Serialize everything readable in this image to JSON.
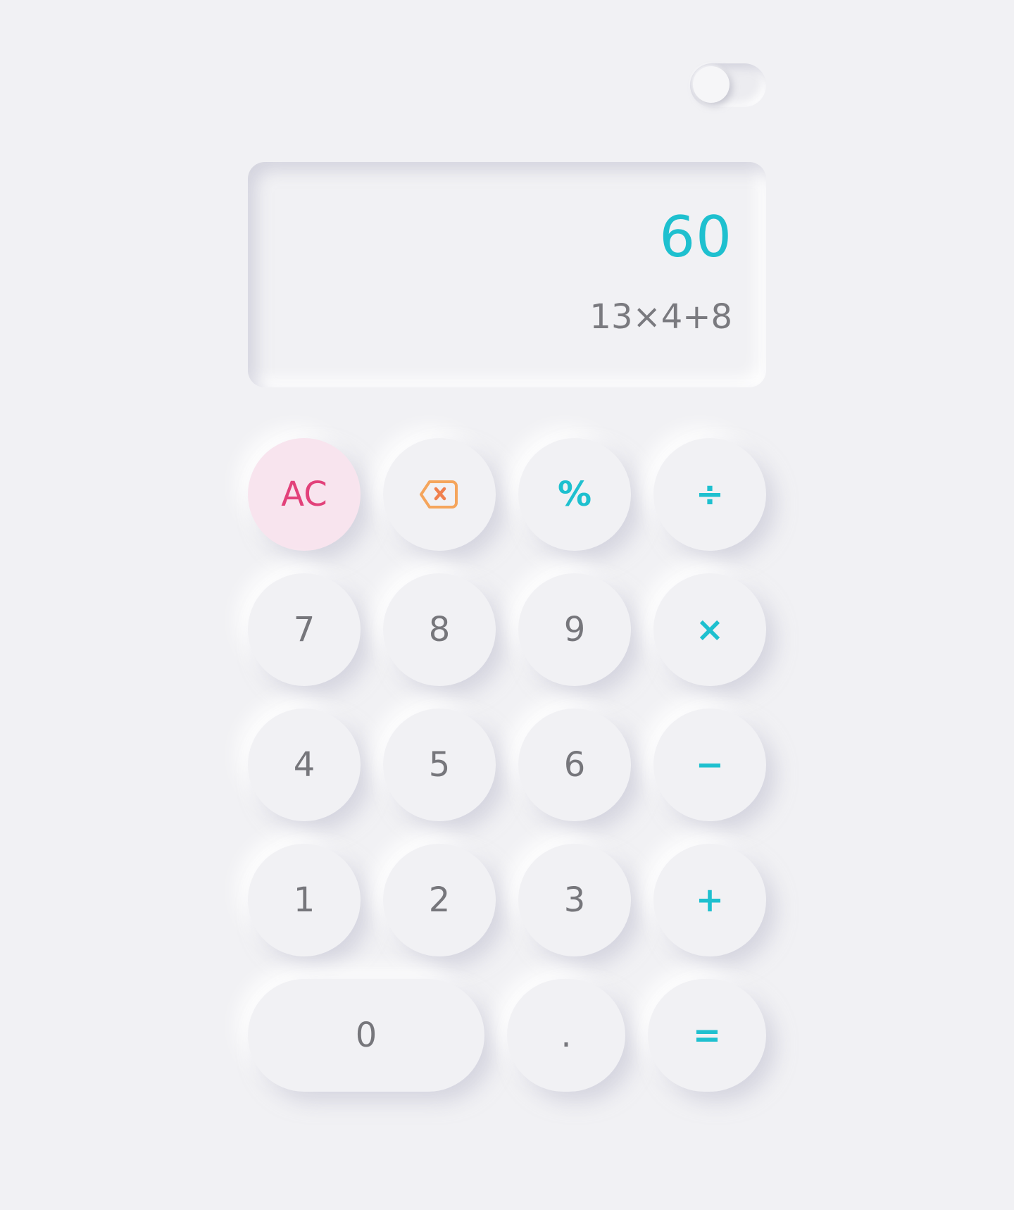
{
  "theme_toggle": {
    "state": "off"
  },
  "display": {
    "result": "60",
    "expression": "13×4+8"
  },
  "colors": {
    "background": "#f1f1f4",
    "accent": "#1ec0cf",
    "clear": "#e2417a",
    "clear_bg": "#f8e4ee",
    "backspace": "#f5a55c",
    "digit": "#76767b"
  },
  "keys": {
    "clear": "AC",
    "backspace_icon": "backspace-icon",
    "percent": "%",
    "divide": "÷",
    "seven": "7",
    "eight": "8",
    "nine": "9",
    "multiply": "×",
    "four": "4",
    "five": "5",
    "six": "6",
    "minus": "−",
    "one": "1",
    "two": "2",
    "three": "3",
    "plus": "+",
    "zero": "0",
    "decimal": ".",
    "equals": "="
  }
}
